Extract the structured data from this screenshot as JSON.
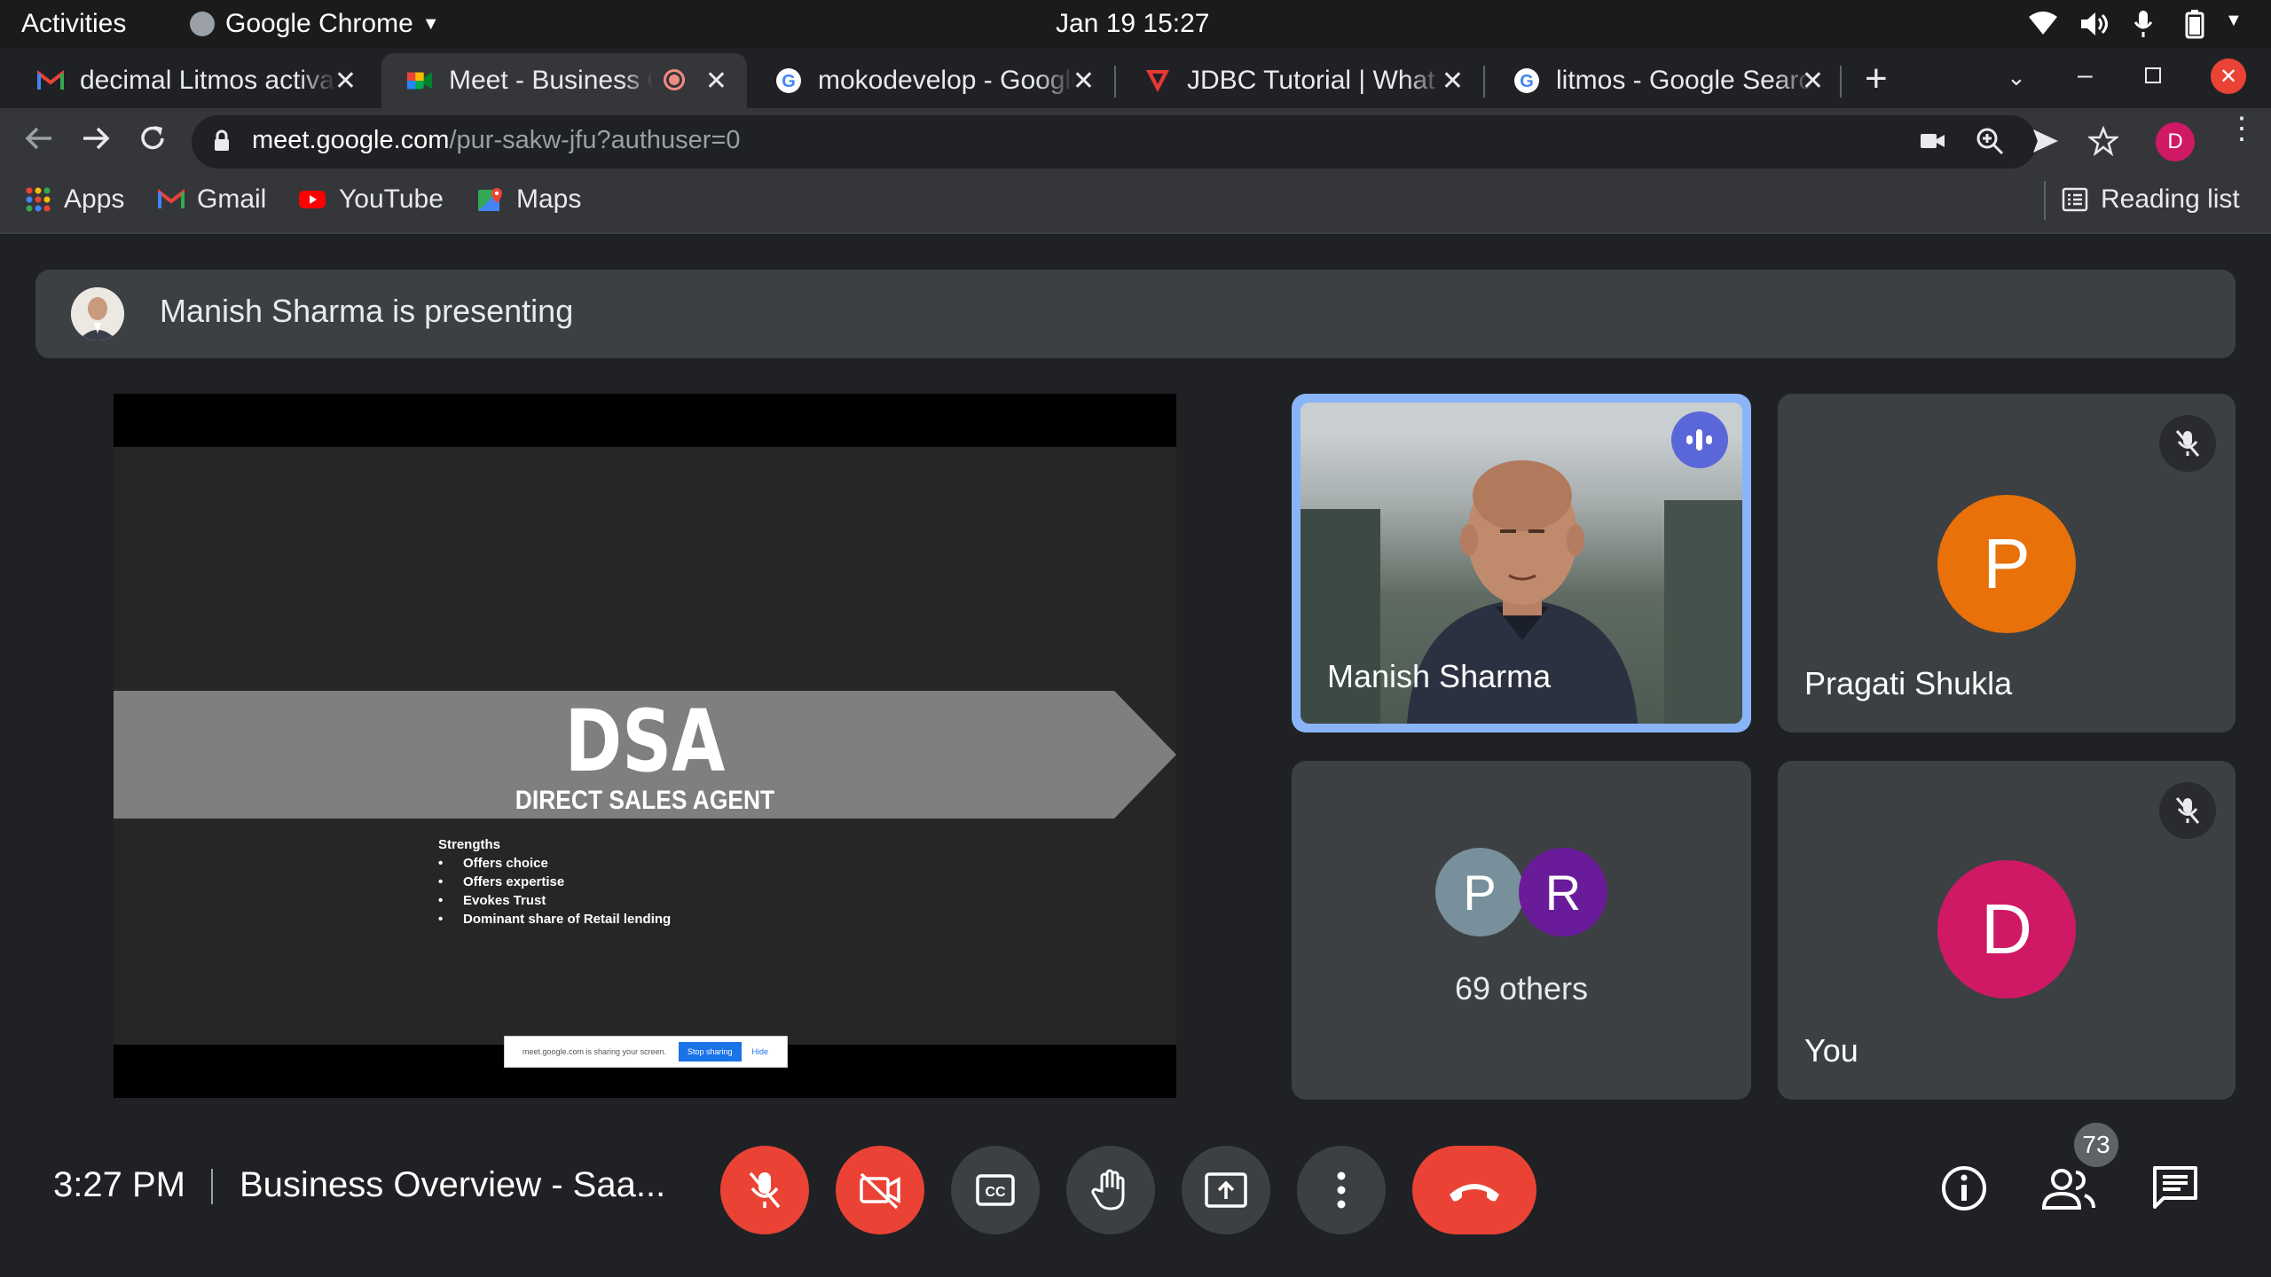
{
  "system_bar": {
    "activities": "Activities",
    "app_name": "Google Chrome",
    "datetime": "Jan 19  15:27"
  },
  "tabs": [
    {
      "title": "decimal Litmos activa",
      "icon": "gmail-icon"
    },
    {
      "title": "Meet - Business Ov",
      "icon": "meet-icon",
      "recording": true
    },
    {
      "title": "mokodevelop - Google",
      "icon": "google-icon"
    },
    {
      "title": "JDBC Tutorial | What",
      "icon": "javatpoint-icon"
    },
    {
      "title": "litmos - Google Search",
      "icon": "google-icon"
    }
  ],
  "omnibox": {
    "host": "meet.google.com",
    "path": "/pur-sakw-jfu?authuser=0"
  },
  "profile_initial": "D",
  "bookmarks": [
    {
      "label": "Apps",
      "icon": "apps-grid-icon"
    },
    {
      "label": "Gmail",
      "icon": "gmail-icon"
    },
    {
      "label": "YouTube",
      "icon": "youtube-icon"
    },
    {
      "label": "Maps",
      "icon": "maps-icon"
    }
  ],
  "reading_list": "Reading list",
  "meet": {
    "presenting_banner": "Manish Sharma is presenting",
    "slide": {
      "title": "DSA",
      "subtitle": "DIRECT SALES AGENT",
      "list_heading": "Strengths",
      "items": [
        "Offers choice",
        "Offers expertise",
        "Evokes Trust",
        "Dominant share of Retail lending"
      ],
      "share_notice": "meet.google.com is sharing your screen.",
      "stop_sharing": "Stop sharing",
      "hide": "Hide"
    },
    "participants": [
      {
        "name": "Manish Sharma",
        "speaking": true
      },
      {
        "name": "Pragati Shukla",
        "initial": "P",
        "color": "#e8710a",
        "muted": true
      },
      {
        "group_label": "69 others",
        "initials": [
          "P",
          "R"
        ],
        "colors": [
          "#78909c",
          "#6a1b9a"
        ]
      },
      {
        "name": "You",
        "initial": "D",
        "color": "#d01965",
        "muted": true
      }
    ],
    "time": "3:27 PM",
    "meeting_title": "Business Overview - Saa...",
    "participant_count": "73",
    "colors": {
      "hangup": "#ea4335",
      "speaking_border": "#8ab4f8",
      "active_speaker_badge": "#5a67d8"
    }
  }
}
